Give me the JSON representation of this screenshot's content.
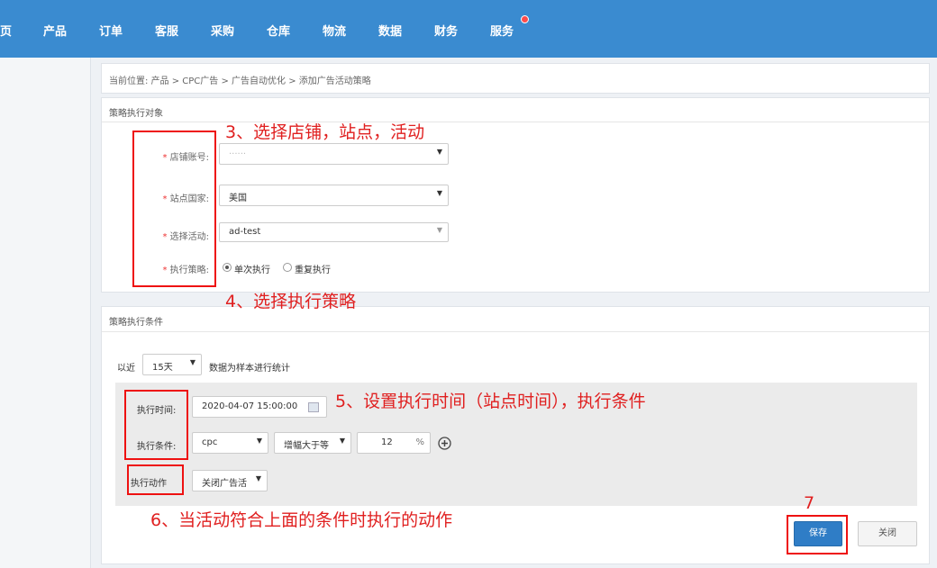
{
  "nav": {
    "items": [
      "页",
      "产品",
      "订单",
      "客服",
      "采购",
      "仓库",
      "物流",
      "数据",
      "财务",
      "服务"
    ]
  },
  "breadcrumb": "当前位置:  产品 > CPC广告 > 广告自动优化 > 添加广告活动策略",
  "target_panel": {
    "title": "策略执行对象",
    "store_label": "店铺账号:",
    "store_value": "",
    "site_label": "站点国家:",
    "site_value": "美国",
    "activity_label": "选择活动:",
    "activity_value": "ad-test",
    "strategy_label": "执行策略:",
    "strategy_opt1": "单次执行",
    "strategy_opt2": "重复执行"
  },
  "condition_panel": {
    "title": "策略执行条件",
    "recent_prefix": "以近",
    "recent_value": "15天",
    "recent_suffix": "数据为样本进行统计",
    "time_label": "执行时间:",
    "time_value": "2020-04-07 15:00:00",
    "cond_label": "执行条件:",
    "cond_metric": "cpc",
    "cond_op": "增幅大于等",
    "cond_value": "12",
    "cond_unit": "%",
    "action_label": "执行动作",
    "action_value": "关闭广告活"
  },
  "buttons": {
    "save": "保存",
    "close": "关闭"
  },
  "annotations": {
    "a3": "3、选择店铺，站点，活动",
    "a4": "4、选择执行策略",
    "a5": "5、设置执行时间（站点时间），执行条件",
    "a6": "6、当活动符合上面的条件时执行的动作",
    "a7": "7"
  },
  "colors": {
    "nav": "#3a8bd0",
    "annotation": "#e02020",
    "primary": "#2f7dc6"
  }
}
